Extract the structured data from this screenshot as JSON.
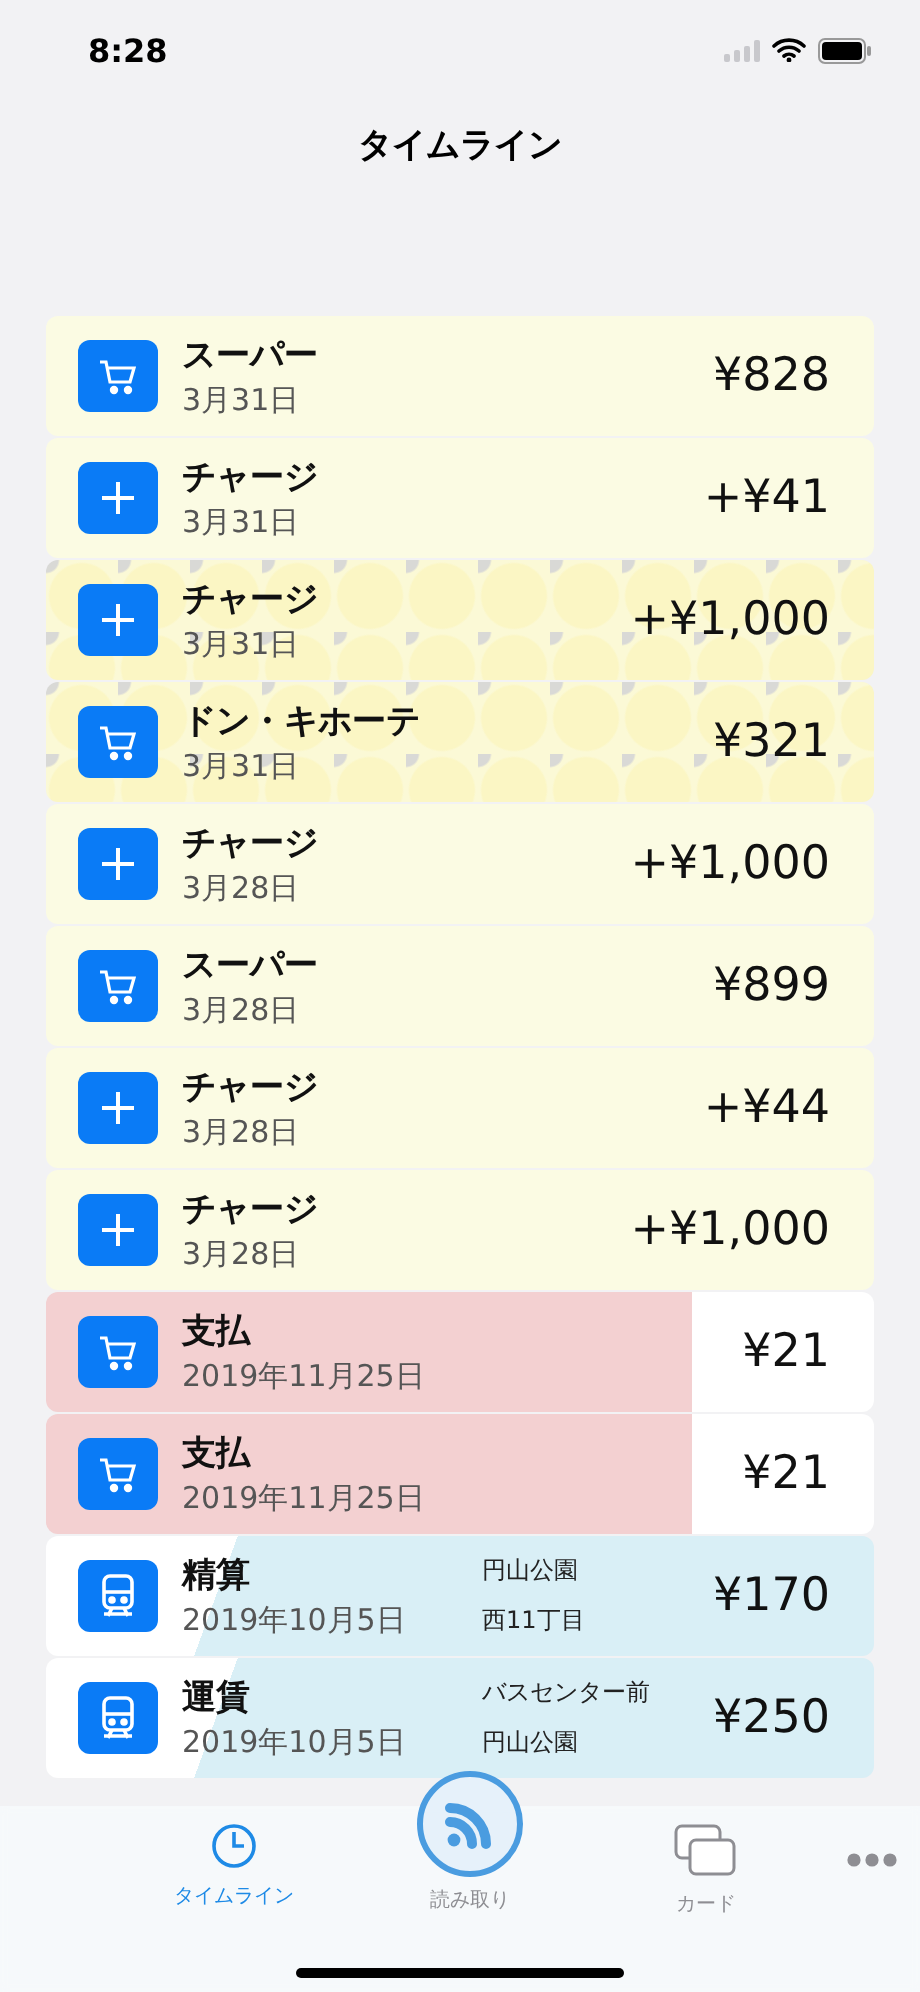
{
  "status_bar": {
    "time": "8:28"
  },
  "navigation": {
    "title": "タイムライン"
  },
  "transactions": [
    {
      "kind": "cart",
      "color": "#fbfbe3",
      "patterned": false,
      "logo_panel": false,
      "title": "スーパー",
      "date": "3月31日",
      "amount": "¥828"
    },
    {
      "kind": "charge",
      "color": "#fbfbe3",
      "patterned": false,
      "logo_panel": false,
      "title": "チャージ",
      "date": "3月31日",
      "amount": "+¥41"
    },
    {
      "kind": "charge",
      "color": "#fbf9d6",
      "patterned": true,
      "logo_panel": false,
      "title": "チャージ",
      "date": "3月31日",
      "amount": "+¥1,000"
    },
    {
      "kind": "cart",
      "color": "#fbf9d6",
      "patterned": true,
      "logo_panel": false,
      "title": "ドン・キホーテ",
      "date": "3月31日",
      "amount": "¥321"
    },
    {
      "kind": "charge",
      "color": "#fbfbe3",
      "patterned": false,
      "logo_panel": false,
      "title": "チャージ",
      "date": "3月28日",
      "amount": "+¥1,000"
    },
    {
      "kind": "cart",
      "color": "#fbfbe3",
      "patterned": false,
      "logo_panel": false,
      "title": "スーパー",
      "date": "3月28日",
      "amount": "¥899"
    },
    {
      "kind": "charge",
      "color": "#fbfbe3",
      "patterned": false,
      "logo_panel": false,
      "title": "チャージ",
      "date": "3月28日",
      "amount": "+¥44"
    },
    {
      "kind": "charge",
      "color": "#fbfbe3",
      "patterned": false,
      "logo_panel": false,
      "title": "チャージ",
      "date": "3月28日",
      "amount": "+¥1,000"
    },
    {
      "kind": "cart",
      "color": "#f3d0d1",
      "patterned": false,
      "logo_panel": true,
      "title": "支払",
      "date": "2019年11月25日",
      "amount": "¥21"
    },
    {
      "kind": "cart",
      "color": "#f3d0d1",
      "patterned": false,
      "logo_panel": true,
      "title": "支払",
      "date": "2019年11月25日",
      "amount": "¥21"
    },
    {
      "kind": "train",
      "color": "#d9eff6",
      "patterned": false,
      "logo_panel": false,
      "title": "精算",
      "date": "2019年10月5日",
      "from": "円山公園",
      "to": "西11丁目",
      "amount": "¥170"
    },
    {
      "kind": "train",
      "color": "#d9eff6",
      "patterned": false,
      "logo_panel": false,
      "title": "運賃",
      "date": "2019年10月5日",
      "from": "バスセンター前",
      "to": "円山公園",
      "amount": "¥250"
    }
  ],
  "tab_bar": {
    "items": [
      {
        "kind": "clock",
        "label": "タイムライン",
        "selected": true
      },
      {
        "kind": "scan",
        "label": "読み取り",
        "selected": false
      },
      {
        "kind": "cards",
        "label": "カード",
        "selected": false
      },
      {
        "kind": "more",
        "selected": false
      }
    ]
  }
}
